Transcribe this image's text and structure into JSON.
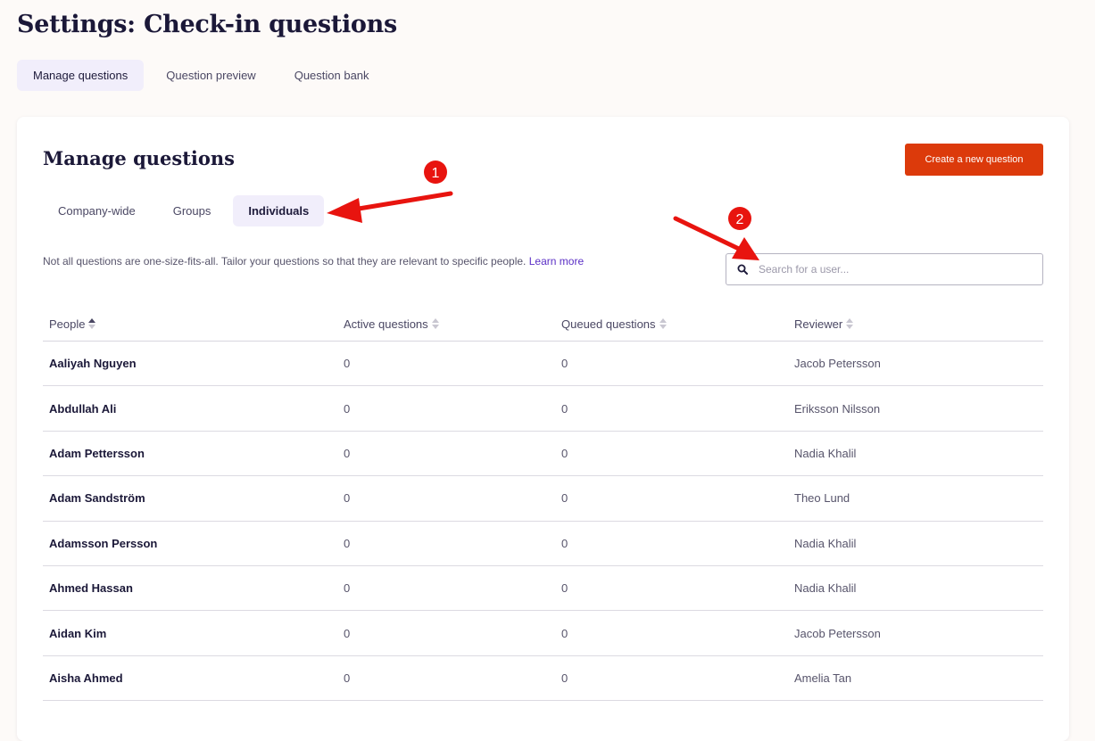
{
  "page": {
    "title": "Settings: Check-in questions"
  },
  "top_tabs": [
    {
      "label": "Manage questions",
      "active": true
    },
    {
      "label": "Question preview",
      "active": false
    },
    {
      "label": "Question bank",
      "active": false
    }
  ],
  "card": {
    "title": "Manage questions",
    "create_button": "Create a new question",
    "sub_tabs": [
      {
        "label": "Company-wide",
        "active": false
      },
      {
        "label": "Groups",
        "active": false
      },
      {
        "label": "Individuals",
        "active": true
      }
    ],
    "description": "Not all questions are one-size-fits-all. Tailor your questions so that they are relevant to specific people.",
    "learn_more": "Learn more",
    "search_placeholder": "Search for a user..."
  },
  "table": {
    "columns": [
      {
        "label": "People",
        "sort": "asc"
      },
      {
        "label": "Active questions",
        "sort": "none"
      },
      {
        "label": "Queued questions",
        "sort": "none"
      },
      {
        "label": "Reviewer",
        "sort": "none"
      }
    ],
    "rows": [
      {
        "person": "Aaliyah Nguyen",
        "active": "0",
        "queued": "0",
        "reviewer": "Jacob Petersson"
      },
      {
        "person": "Abdullah Ali",
        "active": "0",
        "queued": "0",
        "reviewer": "Eriksson Nilsson"
      },
      {
        "person": "Adam Pettersson",
        "active": "0",
        "queued": "0",
        "reviewer": "Nadia Khalil"
      },
      {
        "person": "Adam Sandström",
        "active": "0",
        "queued": "0",
        "reviewer": "Theo Lund"
      },
      {
        "person": "Adamsson Persson",
        "active": "0",
        "queued": "0",
        "reviewer": "Nadia Khalil"
      },
      {
        "person": "Ahmed Hassan",
        "active": "0",
        "queued": "0",
        "reviewer": "Nadia Khalil"
      },
      {
        "person": "Aidan Kim",
        "active": "0",
        "queued": "0",
        "reviewer": "Jacob Petersson"
      },
      {
        "person": "Aisha Ahmed",
        "active": "0",
        "queued": "0",
        "reviewer": "Amelia Tan"
      }
    ]
  },
  "annotations": {
    "marker_1": "1",
    "marker_2": "2",
    "color": "#e8140f"
  },
  "colors": {
    "accent": "#dc3a0b",
    "link": "#5a2ec5",
    "active_tab_bg": "#f1eefb"
  }
}
